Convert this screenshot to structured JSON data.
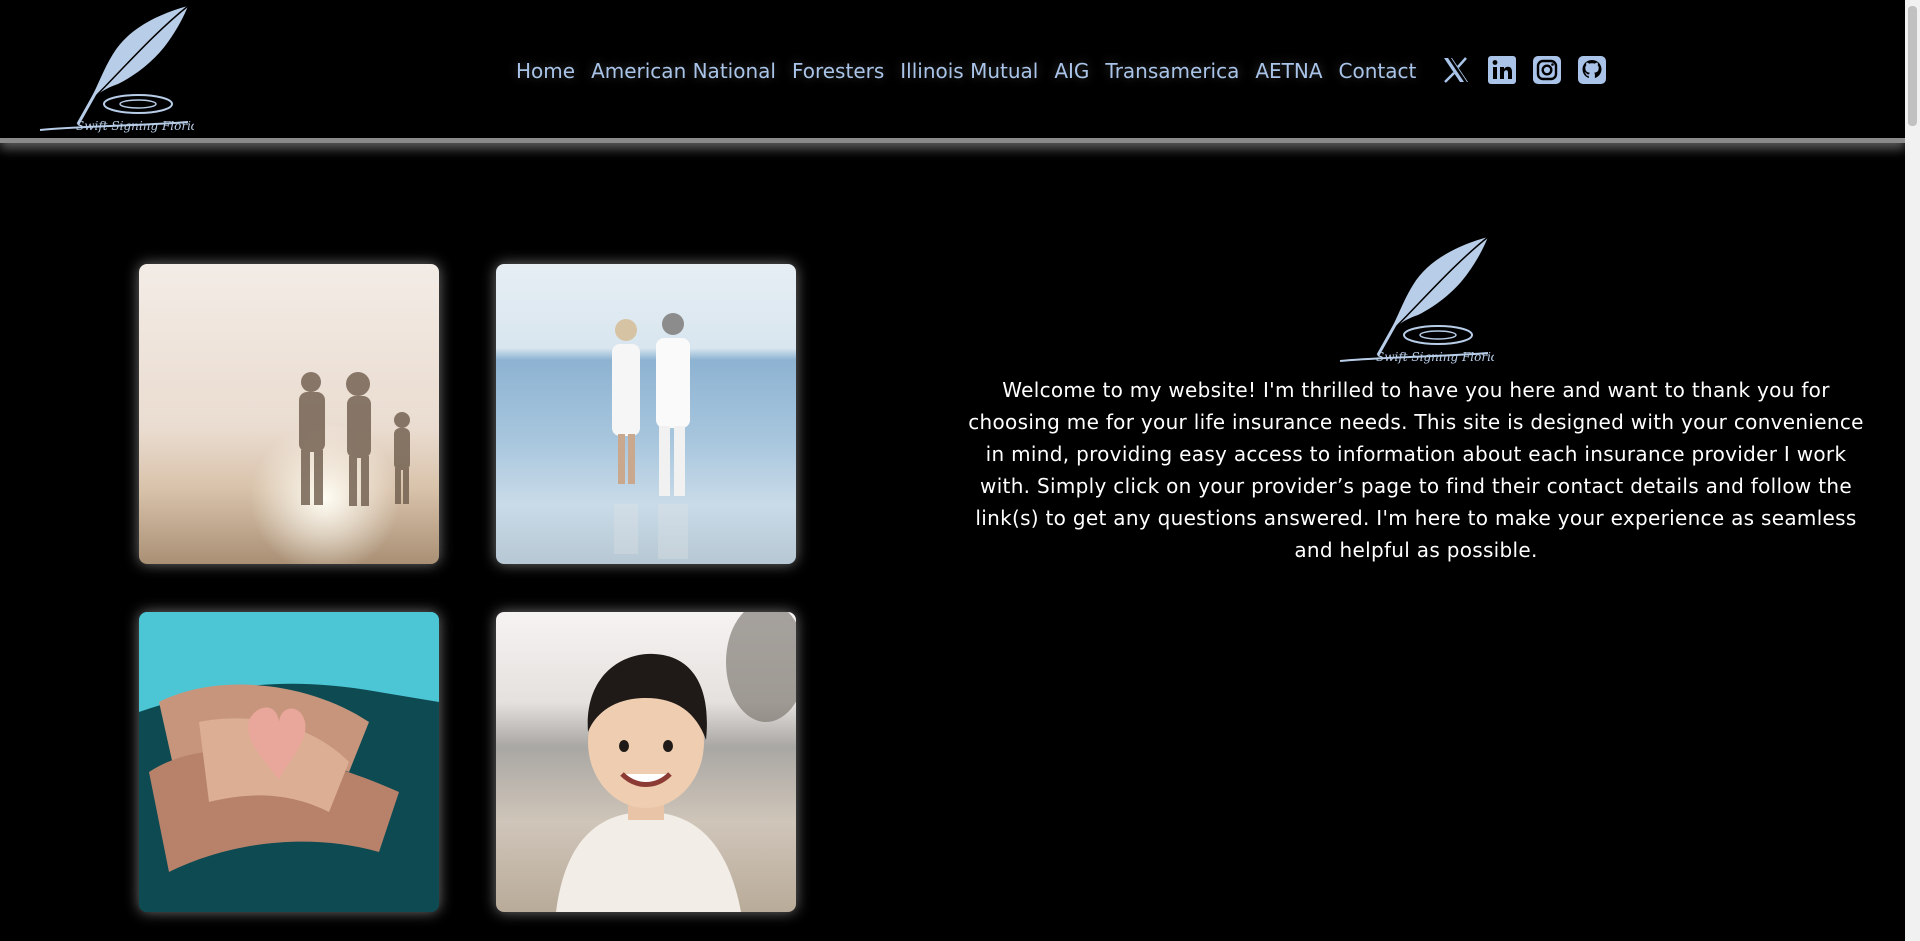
{
  "brand": {
    "logo_text": "Swift Signing Florida",
    "logo_icon": "quill-feather-icon",
    "accent_color": "#a9c4e8"
  },
  "nav": {
    "items": [
      {
        "label": "Home"
      },
      {
        "label": "American National"
      },
      {
        "label": "Foresters"
      },
      {
        "label": "Illinois Mutual"
      },
      {
        "label": "AIG"
      },
      {
        "label": "Transamerica"
      },
      {
        "label": "AETNA"
      },
      {
        "label": "Contact"
      }
    ],
    "social": [
      {
        "icon": "x-twitter-icon"
      },
      {
        "icon": "linkedin-icon"
      },
      {
        "icon": "instagram-icon"
      },
      {
        "icon": "github-icon"
      }
    ]
  },
  "gallery": {
    "images": [
      {
        "subject": "family-on-beach-at-sunset"
      },
      {
        "subject": "elderly-couple-walking-on-beach"
      },
      {
        "subject": "hands-holding-heart"
      },
      {
        "subject": "smiling-child-on-beach"
      }
    ]
  },
  "main": {
    "welcome_text": "Welcome to my website! I'm thrilled to have you here and want to thank you for choosing me for your life insurance needs. This site is designed with your convenience in mind, providing easy access to information about each insurance provider I work with. Simply click on your provider’s page to find their contact details and follow the link(s) to get any questions answered. I'm here to make your experience as seamless and helpful as possible."
  }
}
